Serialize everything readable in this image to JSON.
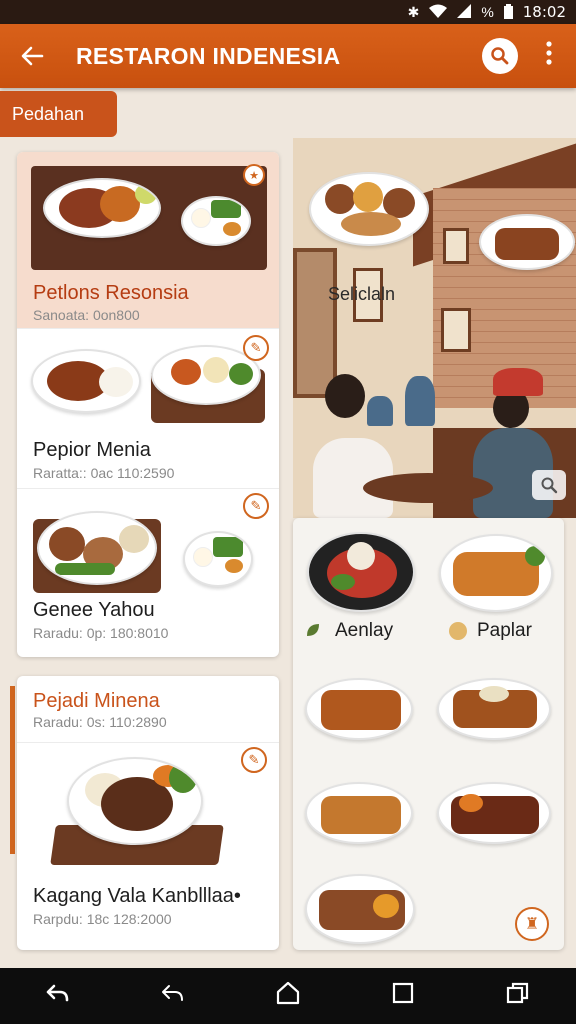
{
  "status_bar": {
    "time": "18:02",
    "icons": [
      "bluetooth-icon",
      "wifi-icon",
      "signal-icon",
      "battery-icon"
    ],
    "battery_label": "%"
  },
  "app_bar": {
    "title": "RESTARON INDENESIA",
    "back_icon": "arrow-left-icon",
    "search_icon": "search-icon",
    "more_icon": "more-vertical-icon"
  },
  "chip": {
    "label": "Pedahan"
  },
  "left_list": [
    {
      "title": "Petlons Resonsia",
      "subtitle": "Sanoata: 0on800",
      "featured": true
    },
    {
      "title": "Pepior Menia",
      "subtitle": "Raratta:: 0ac 110:2590"
    },
    {
      "title": "Genee Yahou",
      "subtitle": "Raradu: 0p: 180:8010"
    }
  ],
  "left_list_2": {
    "header_title": "Pejadi Minena",
    "header_subtitle": "Raradu: 0s: 110:2890",
    "item": {
      "title": "Kagang Vala Kanblllaa•",
      "subtitle": "Rarpdu: 18c 128:2000"
    }
  },
  "scene": {
    "label": "Seliclaln"
  },
  "right_grid": {
    "labels": [
      {
        "text": "Aenlay",
        "icon": "leaf-icon"
      },
      {
        "text": "Paplar",
        "icon": "coin-icon"
      }
    ]
  },
  "nav_bar": {
    "buttons": [
      "back-icon",
      "undo-icon",
      "home-icon",
      "recents-icon",
      "overview-icon"
    ]
  },
  "colors": {
    "accent": "#c9531b",
    "app_bar": "#d15a16",
    "background": "#efe7dd"
  }
}
